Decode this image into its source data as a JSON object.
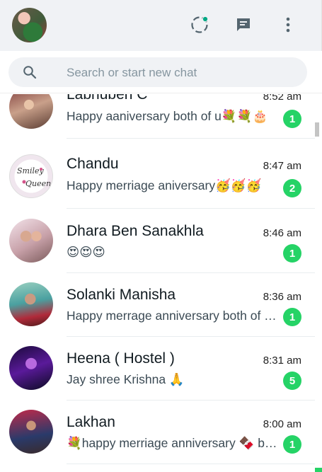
{
  "header": {
    "profile": "profile-avatar",
    "icons": [
      "status-icon",
      "new-chat-icon",
      "menu-icon"
    ],
    "accent_color": "#00a884"
  },
  "search": {
    "placeholder": "Search or start new chat",
    "value": ""
  },
  "chats": [
    {
      "name": "Labhuben C",
      "time": "8:52 am",
      "message": "Happy aaniversary both of u💐💐🎂",
      "unread": "1"
    },
    {
      "name": "Chandu",
      "time": "8:47 am",
      "message": "Happy merriage aniversary🥳🥳🥳",
      "unread": "2"
    },
    {
      "name": "Dhara Ben Sanakhla",
      "time": "8:46 am",
      "message": "😍😍😍",
      "unread": "1"
    },
    {
      "name": "Solanki Manisha",
      "time": "8:36 am",
      "message": "Happy merrage anniversary both of you",
      "unread": "1"
    },
    {
      "name": "Heena ( Hostel )",
      "time": "8:31 am",
      "message": "Jay shree Krishna 🙏",
      "unread": "5"
    },
    {
      "name": "Lakhan",
      "time": "8:00 am",
      "message": "💐happy merriage anniversary 🍫 both of you",
      "unread": "1"
    }
  ],
  "colors": {
    "unread_badge": "#25d366",
    "header_bg": "#f0f2f5"
  }
}
